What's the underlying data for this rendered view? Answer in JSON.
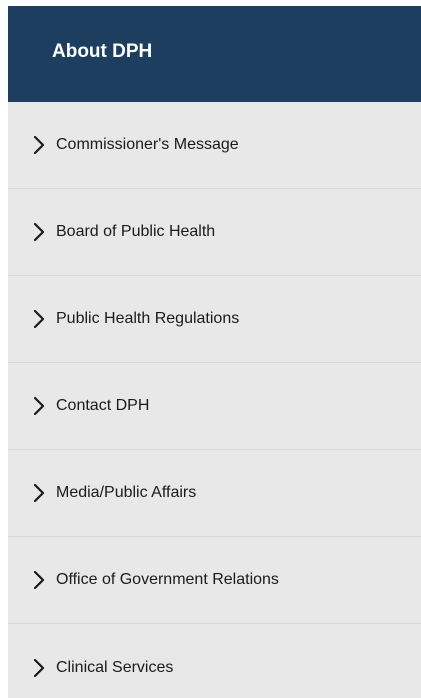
{
  "sidebar": {
    "title": "About DPH",
    "items": [
      {
        "label": "Commissioner's Message",
        "icon": "chevron-right-icon"
      },
      {
        "label": "Board of Public Health",
        "icon": "chevron-right-icon"
      },
      {
        "label": "Public Health Regulations",
        "icon": "chevron-right-icon"
      },
      {
        "label": "Contact DPH",
        "icon": "chevron-right-icon"
      },
      {
        "label": "Media/Public Affairs",
        "icon": "chevron-right-icon"
      },
      {
        "label": "Office of Government Relations",
        "icon": "chevron-right-icon"
      },
      {
        "label": "Clinical Services",
        "icon": "chevron-right-icon"
      }
    ]
  },
  "colors": {
    "header_bg": "#1e3e60",
    "list_bg": "#e8e8e8",
    "divider": "#d6d6d6",
    "text": "#1a1a1a"
  }
}
